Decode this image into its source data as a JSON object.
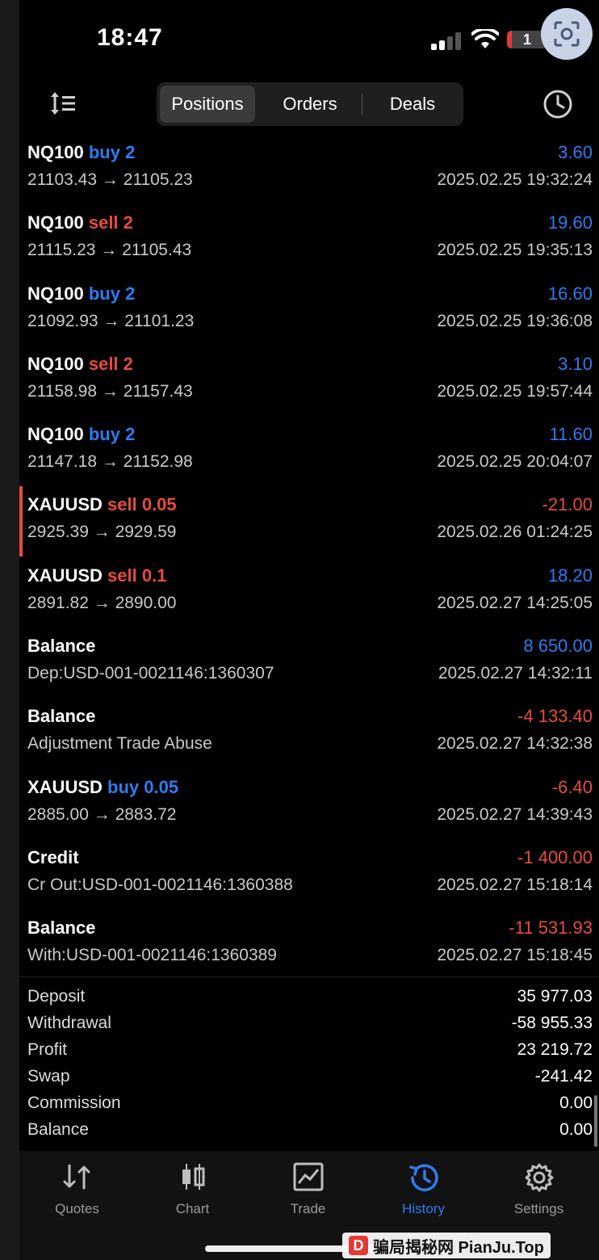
{
  "status_bar": {
    "time": "18:47",
    "battery": "1"
  },
  "nav": {
    "tabs": [
      "Positions",
      "Orders",
      "Deals"
    ],
    "active_tab": "Positions"
  },
  "rows": [
    {
      "symbol": "NQ100",
      "side": "buy 2",
      "side_type": "buy",
      "profit": "3.60",
      "profit_sign": "pos",
      "detail": "21103.43 → 21105.23",
      "datetime": "2025.02.25 19:32:24"
    },
    {
      "symbol": "NQ100",
      "side": "sell 2",
      "side_type": "sell",
      "profit": "19.60",
      "profit_sign": "pos",
      "detail": "21115.23 → 21105.43",
      "datetime": "2025.02.25 19:35:13"
    },
    {
      "symbol": "NQ100",
      "side": "buy 2",
      "side_type": "buy",
      "profit": "16.60",
      "profit_sign": "pos",
      "detail": "21092.93 → 21101.23",
      "datetime": "2025.02.25 19:36:08"
    },
    {
      "symbol": "NQ100",
      "side": "sell 2",
      "side_type": "sell",
      "profit": "3.10",
      "profit_sign": "pos",
      "detail": "21158.98 → 21157.43",
      "datetime": "2025.02.25 19:57:44"
    },
    {
      "symbol": "NQ100",
      "side": "buy 2",
      "side_type": "buy",
      "profit": "11.60",
      "profit_sign": "pos",
      "detail": "21147.18 → 21152.98",
      "datetime": "2025.02.25 20:04:07"
    },
    {
      "symbol": "XAUUSD",
      "side": "sell 0.05",
      "side_type": "sell",
      "profit": "-21.00",
      "profit_sign": "neg",
      "detail": "2925.39 → 2929.59",
      "datetime": "2025.02.26 01:24:25",
      "marked": true
    },
    {
      "symbol": "XAUUSD",
      "side": "sell 0.1",
      "side_type": "sell",
      "profit": "18.20",
      "profit_sign": "pos",
      "detail": "2891.82 → 2890.00",
      "datetime": "2025.02.27 14:25:05"
    },
    {
      "symbol": "Balance",
      "side": "",
      "side_type": "",
      "profit": "8 650.00",
      "profit_sign": "pos",
      "detail": "Dep:USD-001-0021146:1360307",
      "datetime": "2025.02.27 14:32:11"
    },
    {
      "symbol": "Balance",
      "side": "",
      "side_type": "",
      "profit": "-4 133.40",
      "profit_sign": "neg",
      "detail": "Adjustment Trade Abuse",
      "datetime": "2025.02.27 14:32:38"
    },
    {
      "symbol": "XAUUSD",
      "side": "buy 0.05",
      "side_type": "buy",
      "profit": "-6.40",
      "profit_sign": "neg",
      "detail": "2885.00 → 2883.72",
      "datetime": "2025.02.27 14:39:43"
    },
    {
      "symbol": "Credit",
      "side": "",
      "side_type": "",
      "profit": "-1 400.00",
      "profit_sign": "neg",
      "detail": "Cr Out:USD-001-0021146:1360388",
      "datetime": "2025.02.27 15:18:14"
    },
    {
      "symbol": "Balance",
      "side": "",
      "side_type": "",
      "profit": "-11 531.93",
      "profit_sign": "neg",
      "detail": "With:USD-001-0021146:1360389",
      "datetime": "2025.02.27 15:18:45"
    }
  ],
  "summary": [
    {
      "label": "Deposit",
      "value": "35 977.03"
    },
    {
      "label": "Withdrawal",
      "value": "-58 955.33"
    },
    {
      "label": "Profit",
      "value": "23 219.72"
    },
    {
      "label": "Swap",
      "value": "-241.42"
    },
    {
      "label": "Commission",
      "value": "0.00"
    },
    {
      "label": "Balance",
      "value": "0.00"
    }
  ],
  "tabbar": {
    "items": [
      {
        "label": "Quotes",
        "icon": "quotes-icon"
      },
      {
        "label": "Chart",
        "icon": "candlestick-icon"
      },
      {
        "label": "Trade",
        "icon": "trade-chart-icon"
      },
      {
        "label": "History",
        "icon": "history-icon"
      },
      {
        "label": "Settings",
        "icon": "gear-icon"
      }
    ],
    "active": "History"
  },
  "watermark": {
    "text": "骗局揭秘网 PianJu.Top"
  },
  "colors": {
    "buy": "#2f7bf0",
    "sell": "#e74c3c",
    "active_tab": "#2f7bf0",
    "background": "#000000"
  }
}
